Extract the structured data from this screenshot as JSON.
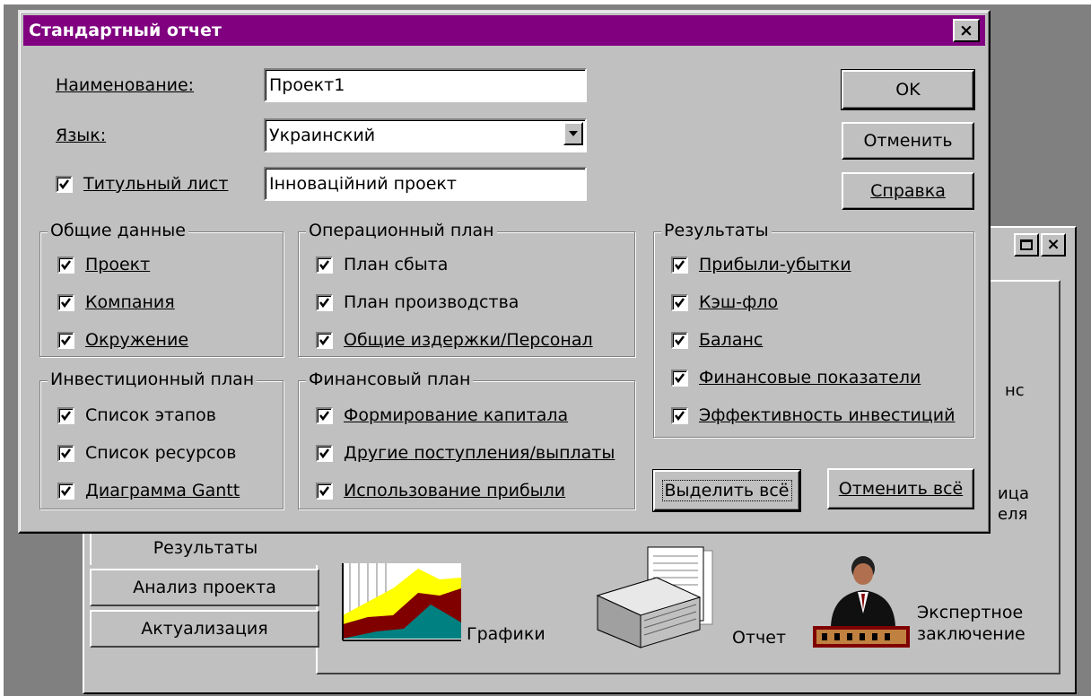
{
  "dialog": {
    "title": "Стандартный отчет",
    "close_glyph": "×",
    "fields": {
      "name_label": "Наименование:",
      "name_value": "Проект1",
      "lang_label": "Язык:",
      "lang_value": "Украинский",
      "title_page_label": "Титульный лист",
      "title_page_value": "Інноваційний проект"
    },
    "buttons": {
      "ok": "OK",
      "cancel": "Отменить",
      "help": "Справка",
      "select_all": "Выделить всё",
      "deselect_all": "Отменить всё"
    },
    "groups": {
      "general": {
        "title": "Общие данные",
        "items": [
          "Проект",
          "Компания",
          "Окружение"
        ]
      },
      "investment": {
        "title": "Инвестиционный план",
        "items": [
          "Список этапов",
          "Список ресурсов",
          "Диаграмма Gantt"
        ]
      },
      "operational": {
        "title": "Операционный план",
        "items": [
          "План сбыта",
          "План производства",
          "Общие издержки/Персонал"
        ]
      },
      "financial": {
        "title": "Финансовый план",
        "items": [
          "Формирование капитала",
          "Другие поступления/выплаты",
          "Использование прибыли"
        ]
      },
      "results": {
        "title": "Результаты",
        "items": [
          "Прибыли-убытки",
          "Кэш-фло",
          "Баланс",
          "Финансовые показатели",
          "Эффективность инвестиций"
        ]
      }
    }
  },
  "background_window": {
    "tabs": [
      "Результаты",
      "Анализ проекта",
      "Актуализация"
    ],
    "tiles": {
      "charts": "Графики",
      "report": "Отчет",
      "expert_line1": "Экспертное",
      "expert_line2": "заключение"
    },
    "partial_text": {
      "a": "нс",
      "b1": "ица",
      "b2": "еля"
    }
  },
  "colors": {
    "titlebar": "#800080",
    "face": "#c0c0c0",
    "desktop": "#808080"
  }
}
